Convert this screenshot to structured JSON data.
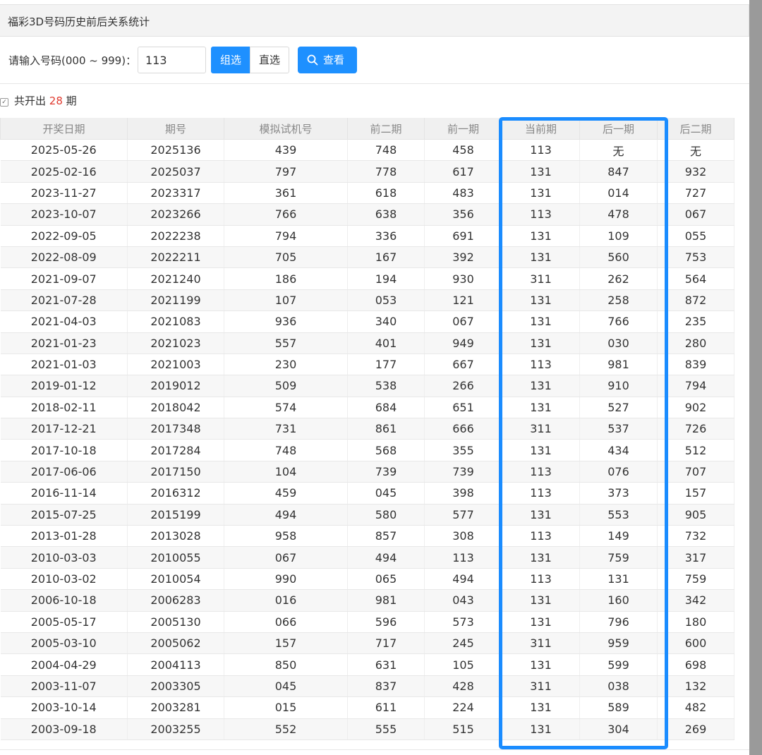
{
  "panel": {
    "title": "福彩3D号码历史前后关系统计"
  },
  "form": {
    "label": "请输入号码(000 ~ 999)：",
    "input_value": "113",
    "mode_group": "组选",
    "mode_direct": "直选",
    "view_button": "查看"
  },
  "summary": {
    "prefix": "共开出",
    "count": "28",
    "suffix": "期"
  },
  "table": {
    "headers": [
      "开奖日期",
      "期号",
      "模拟试机号",
      "前二期",
      "前一期",
      "当前期",
      "后一期",
      "后二期"
    ],
    "rows": [
      [
        "2025-05-26",
        "2025136",
        "439",
        "748",
        "458",
        "113",
        "无",
        "无"
      ],
      [
        "2025-02-16",
        "2025037",
        "797",
        "778",
        "617",
        "131",
        "847",
        "932"
      ],
      [
        "2023-11-27",
        "2023317",
        "361",
        "618",
        "483",
        "131",
        "014",
        "727"
      ],
      [
        "2023-10-07",
        "2023266",
        "766",
        "638",
        "356",
        "113",
        "478",
        "067"
      ],
      [
        "2022-09-05",
        "2022238",
        "794",
        "336",
        "691",
        "131",
        "109",
        "055"
      ],
      [
        "2022-08-09",
        "2022211",
        "705",
        "167",
        "392",
        "131",
        "560",
        "753"
      ],
      [
        "2021-09-07",
        "2021240",
        "186",
        "194",
        "930",
        "311",
        "262",
        "564"
      ],
      [
        "2021-07-28",
        "2021199",
        "107",
        "053",
        "121",
        "131",
        "258",
        "872"
      ],
      [
        "2021-04-03",
        "2021083",
        "936",
        "340",
        "067",
        "131",
        "766",
        "235"
      ],
      [
        "2021-01-23",
        "2021023",
        "557",
        "401",
        "949",
        "131",
        "030",
        "280"
      ],
      [
        "2021-01-03",
        "2021003",
        "230",
        "177",
        "667",
        "113",
        "981",
        "839"
      ],
      [
        "2019-01-12",
        "2019012",
        "509",
        "538",
        "266",
        "131",
        "910",
        "794"
      ],
      [
        "2018-02-11",
        "2018042",
        "574",
        "684",
        "651",
        "131",
        "527",
        "902"
      ],
      [
        "2017-12-21",
        "2017348",
        "731",
        "861",
        "666",
        "311",
        "537",
        "726"
      ],
      [
        "2017-10-18",
        "2017284",
        "748",
        "568",
        "355",
        "131",
        "434",
        "512"
      ],
      [
        "2017-06-06",
        "2017150",
        "104",
        "739",
        "739",
        "113",
        "076",
        "707"
      ],
      [
        "2016-11-14",
        "2016312",
        "459",
        "045",
        "398",
        "113",
        "373",
        "157"
      ],
      [
        "2015-07-25",
        "2015199",
        "494",
        "580",
        "577",
        "131",
        "553",
        "905"
      ],
      [
        "2013-01-28",
        "2013028",
        "958",
        "857",
        "308",
        "113",
        "149",
        "732"
      ],
      [
        "2010-03-03",
        "2010055",
        "067",
        "494",
        "113",
        "131",
        "759",
        "317"
      ],
      [
        "2010-03-02",
        "2010054",
        "990",
        "065",
        "494",
        "113",
        "131",
        "759"
      ],
      [
        "2006-10-18",
        "2006283",
        "016",
        "981",
        "043",
        "131",
        "160",
        "342"
      ],
      [
        "2005-05-17",
        "2005130",
        "066",
        "596",
        "573",
        "131",
        "796",
        "180"
      ],
      [
        "2005-03-10",
        "2005062",
        "157",
        "717",
        "245",
        "311",
        "959",
        "600"
      ],
      [
        "2004-04-29",
        "2004113",
        "850",
        "631",
        "105",
        "131",
        "599",
        "698"
      ],
      [
        "2003-11-07",
        "2003305",
        "045",
        "837",
        "428",
        "311",
        "038",
        "132"
      ],
      [
        "2003-10-14",
        "2003281",
        "015",
        "611",
        "224",
        "131",
        "589",
        "482"
      ],
      [
        "2003-09-18",
        "2003255",
        "552",
        "555",
        "515",
        "131",
        "304",
        "269"
      ]
    ]
  },
  "colors": {
    "accent": "#1e90ff",
    "highlight": "#1a8cff",
    "count": "#e0392e"
  }
}
